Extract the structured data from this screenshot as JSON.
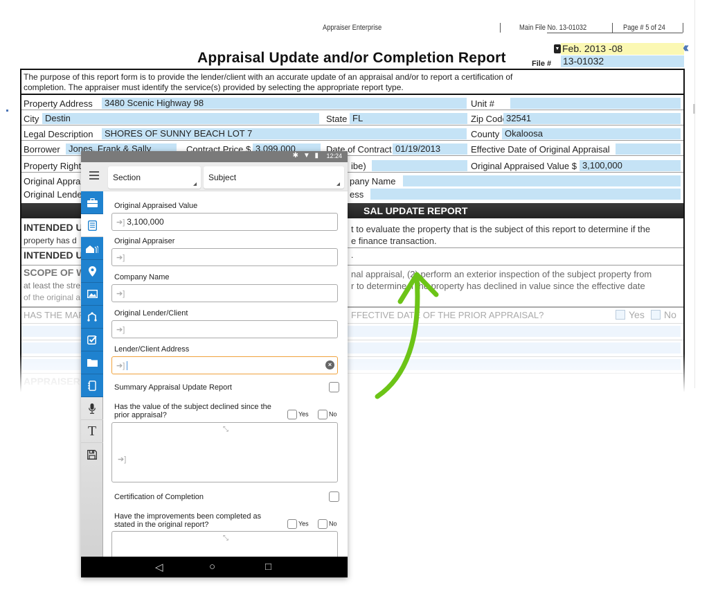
{
  "header": {
    "app_name": "Appraiser Enterprise",
    "main_file_no": "Main File No. 13-01032",
    "page_info": "Page # 5 of 24",
    "report_title": "Appraisal Update and/or Completion Report",
    "date_value": "Feb. 2013 -08",
    "file_label": "File #",
    "file_value": "13-01032",
    "collapse_icon": "double-chevron-left"
  },
  "report": {
    "purpose_line1": "The purpose of this report form is to provide the lender/client with an accurate update of an appraisal and/or to report a certification of",
    "purpose_line2": "completion. The appraiser must identify the service(s) provided by selecting the appropriate report type.",
    "property_address_label": "Property Address",
    "property_address_value": "3480 Scenic Highway 98",
    "unit_label": "Unit #",
    "unit_value": "",
    "city_label": "City",
    "city_value": "Destin",
    "state_label": "State",
    "state_value": "FL",
    "zip_label": "Zip Code",
    "zip_value": "32541",
    "legal_label": "Legal Description",
    "legal_value": "SHORES OF SUNNY BEACH LOT 7",
    "county_label": "County",
    "county_value": "Okaloosa",
    "borrower_label": "Borrower",
    "borrower_value": "Jones, Frank & Sally",
    "contract_price_label": "Contract Price $",
    "contract_price_value": "3,099,000",
    "date_contract_label": "Date of Contract",
    "date_contract_value": "01/19/2013",
    "effective_date_label": "Effective Date of Original Appraisal",
    "effective_date_value": "",
    "property_rights_label": "Property Rights",
    "property_rights_tail": "ibe)",
    "orig_value_label": "Original Appraised Value $",
    "orig_value_value": "3,100,000",
    "orig_appraiser_label": "Original Apprai",
    "company_name_tail": "pany Name",
    "orig_lender_label": "Original Lende",
    "address_tail": "ess",
    "dark_bar_text": "SAL UPDATE REPORT",
    "intended_use_1_left": "INTENDED U",
    "intended_use_1_right": "t to evaluate the property that is the subject of this report to determine if the",
    "intended_use_1_l2_left": "property has d",
    "intended_use_1_l2_right": "e finance transaction.",
    "intended_use_2_left": "INTENDED U",
    "intended_use_2_right": ".",
    "scope_left": "SCOPE OF W",
    "scope_right_l1": "nal appraisal, (2) perform an exterior inspection of the subject property from",
    "scope_l2_left": "at least the stre",
    "scope_right_l2": "r to determine if the property has declined in value since the effective date",
    "scope_l3_left": "of the original a",
    "market_left": "HAS THE MAR",
    "market_right": "FFECTIVE DATE OF THE PRIOR APPRAISAL?",
    "yes_label": "Yes",
    "no_label": "No",
    "appraiser_label": "APPRAISER"
  },
  "tablet": {
    "status_icons": "bluetooth wifi battery",
    "status_time": "12:24",
    "section_select": "Section",
    "subject_select": "Subject",
    "sidebar_icons": [
      "briefcase-icon",
      "form-list-icon",
      "houses-icon",
      "location-pin-icon",
      "photo-icon",
      "sketch-icon",
      "checkbox-icon",
      "folder-icon",
      "notebook-icon"
    ],
    "tool_icons": [
      "microphone-icon",
      "text-icon",
      "save-icon"
    ],
    "fields": [
      {
        "label": "Original Appraised Value",
        "value": "3,100,000"
      },
      {
        "label": "Original Appraiser",
        "value": ""
      },
      {
        "label": "Company Name",
        "value": ""
      },
      {
        "label": "Original Lender/Client",
        "value": ""
      },
      {
        "label": "Lender/Client Address",
        "value": ""
      }
    ],
    "summary_label": "Summary Appraisal Update Report",
    "declined_q_line1": "Has the value of the subject declined since the",
    "declined_q_line2": "prior appraisal?",
    "cert_label": "Certification of Completion",
    "improve_q_line1": "Have the improvements been completed as",
    "improve_q_line2": "stated in the original report?",
    "yes": "Yes",
    "no": "No",
    "nav_back": "◁",
    "nav_home": "○",
    "nav_recent": "□"
  },
  "colors": {
    "accent_blue": "#1f82cf",
    "field_blue": "#c5e3f6",
    "date_yellow": "#fbf8b3",
    "focus_orange": "#f0a23c",
    "arrow_green": "#6cc417"
  }
}
